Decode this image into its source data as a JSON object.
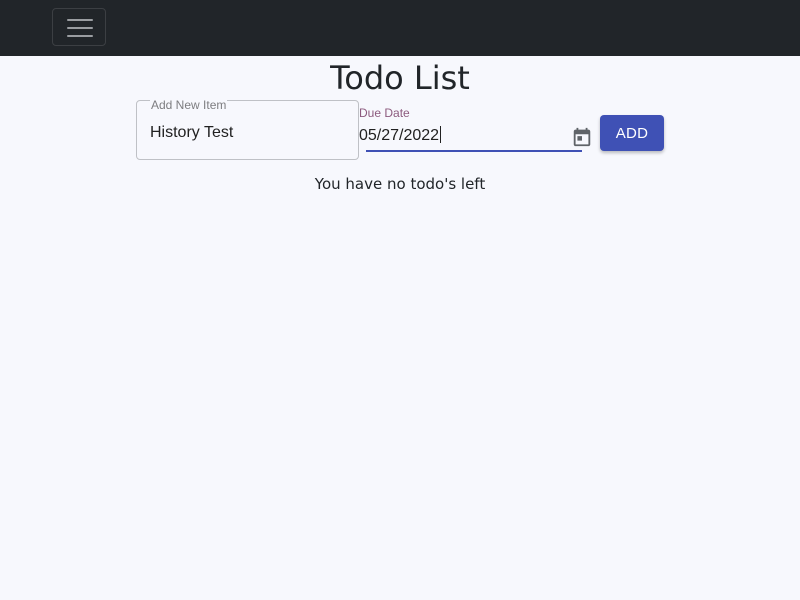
{
  "navbar": {
    "menu_icon": "hamburger-menu-icon",
    "background": "#212529"
  },
  "page": {
    "title": "Todo List"
  },
  "form": {
    "item_label": "Add New Item",
    "item_value": "History Test",
    "date_label": "Due Date",
    "date_value": "05/27/2022",
    "calendar_icon": "calendar-icon",
    "add_label": "ADD",
    "accent_color": "#3f51b5"
  },
  "todos": {
    "empty_message": "You have no todo's left"
  }
}
